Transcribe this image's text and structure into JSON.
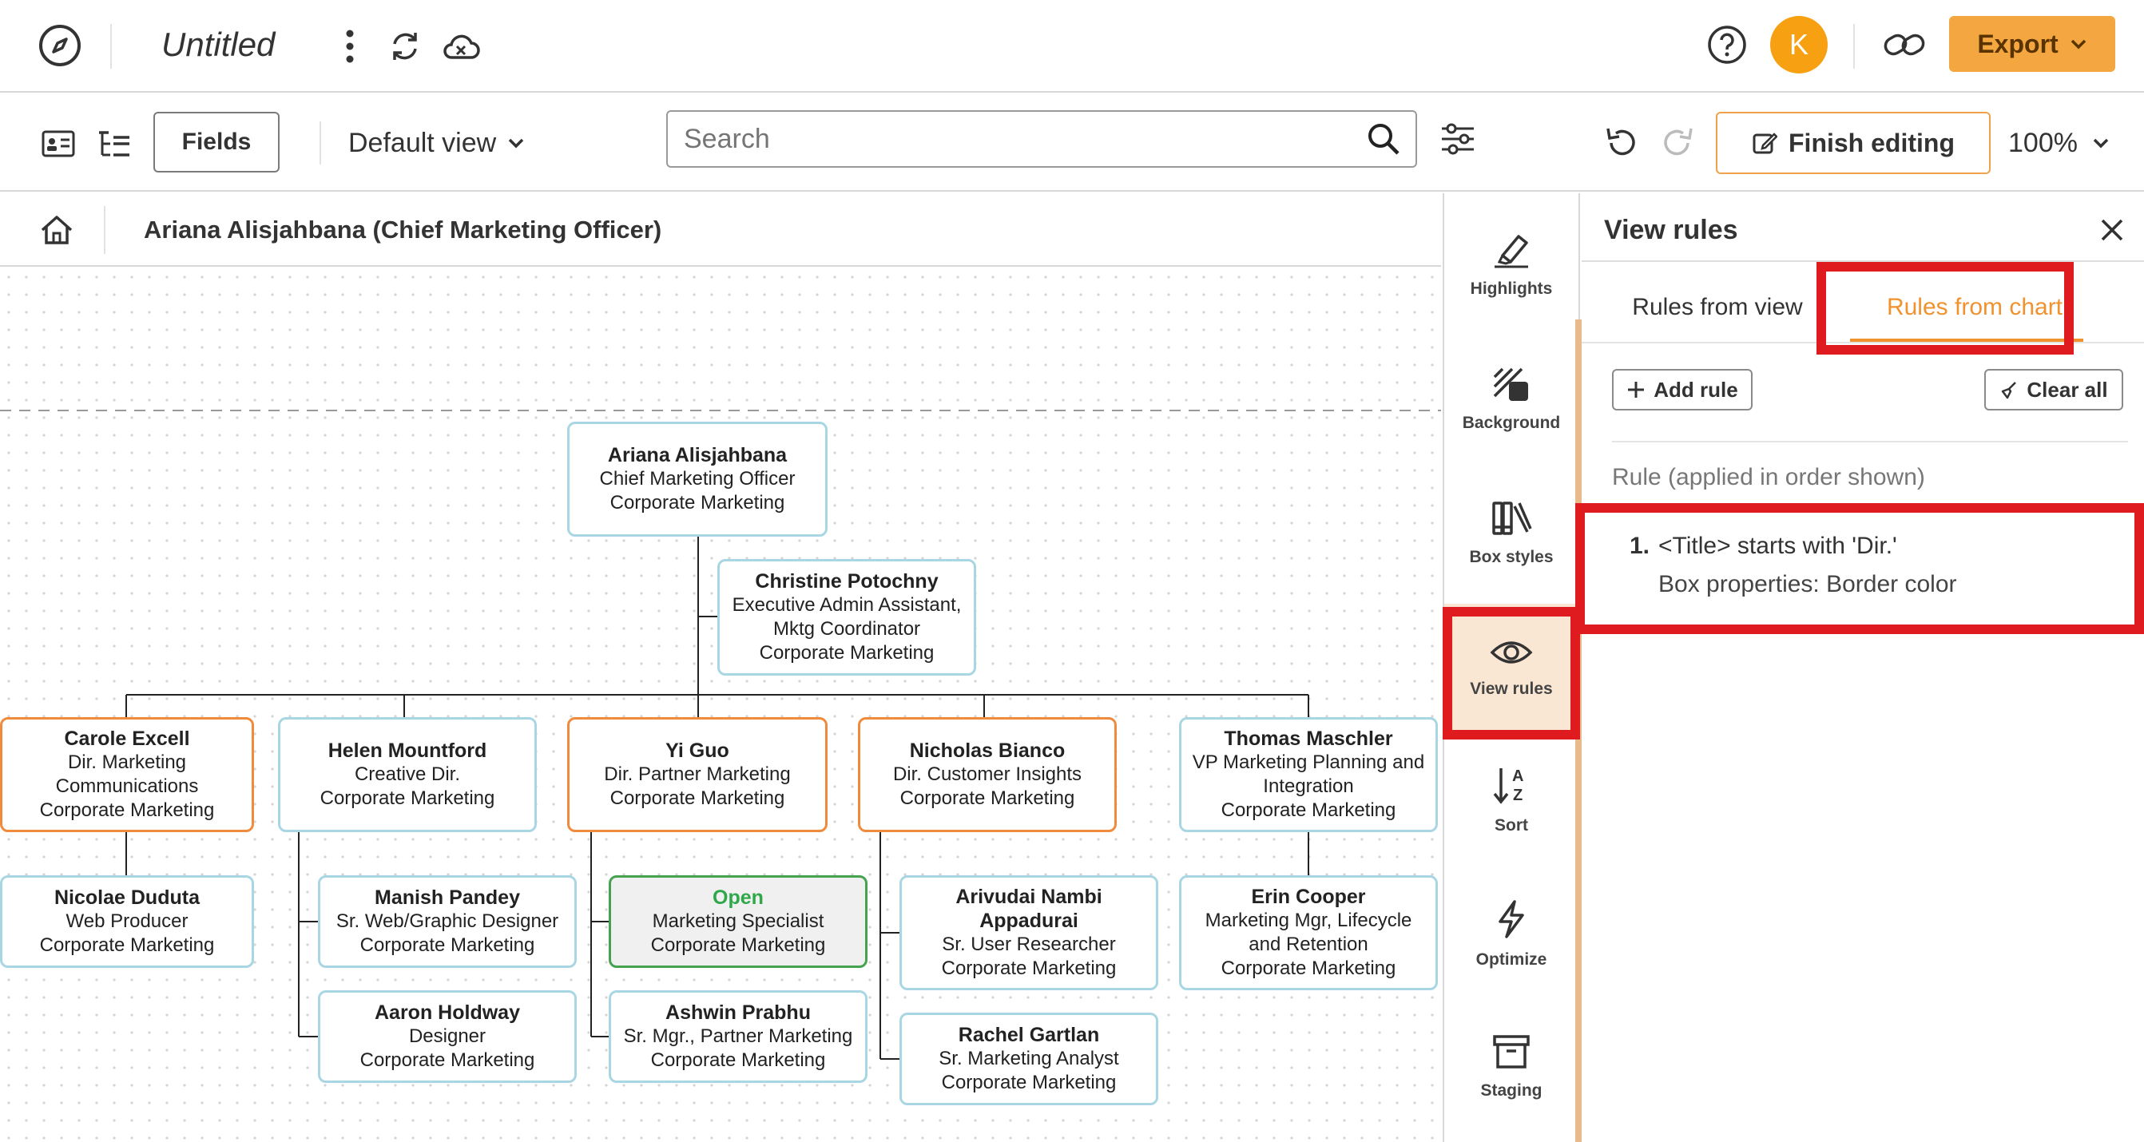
{
  "app": {
    "doc_title": "Untitled",
    "avatar_initial": "K",
    "export_label": "Export",
    "brand_color": "#f4a640"
  },
  "toolbar": {
    "fields_label": "Fields",
    "view_label": "Default view",
    "search_placeholder": "Search",
    "finish_label": "Finish editing",
    "zoom_label": "100%"
  },
  "breadcrumb": {
    "title": "Ariana Alisjahbana (Chief Marketing Officer)"
  },
  "chart": {
    "nodes": [
      {
        "id": "ariana",
        "name": "Ariana Alisjahbana",
        "lines": [
          "Chief Marketing Officer",
          "Corporate Marketing"
        ],
        "style": "normal"
      },
      {
        "id": "christine",
        "name": "Christine Potochny",
        "lines": [
          "Executive Admin Assistant,",
          "Mktg Coordinator",
          "Corporate Marketing"
        ],
        "style": "normal"
      },
      {
        "id": "carole",
        "name": "Carole Excell",
        "lines": [
          "Dir. Marketing",
          "Communications",
          "Corporate Marketing"
        ],
        "style": "dir"
      },
      {
        "id": "helen",
        "name": "Helen Mountford",
        "lines": [
          "Creative Dir.",
          "Corporate Marketing"
        ],
        "style": "normal"
      },
      {
        "id": "yiguo",
        "name": "Yi Guo",
        "lines": [
          "Dir. Partner Marketing",
          "Corporate Marketing"
        ],
        "style": "dir"
      },
      {
        "id": "nicholas",
        "name": "Nicholas Bianco",
        "lines": [
          "Dir. Customer Insights",
          "Corporate Marketing"
        ],
        "style": "dir"
      },
      {
        "id": "thomas",
        "name": "Thomas Maschler",
        "lines": [
          "VP Marketing Planning and",
          "Integration",
          "Corporate Marketing"
        ],
        "style": "normal"
      },
      {
        "id": "nicolae",
        "name": "Nicolae Duduta",
        "lines": [
          "Web Producer",
          "Corporate Marketing"
        ],
        "style": "normal"
      },
      {
        "id": "manish",
        "name": "Manish Pandey",
        "lines": [
          "Sr. Web/Graphic Designer",
          "Corporate Marketing"
        ],
        "style": "normal"
      },
      {
        "id": "aaron",
        "name": "Aaron Holdway",
        "lines": [
          "Designer",
          "Corporate Marketing"
        ],
        "style": "normal"
      },
      {
        "id": "open",
        "name": "Open",
        "lines": [
          "Marketing Specialist",
          "Corporate Marketing"
        ],
        "style": "open"
      },
      {
        "id": "ashwin",
        "name": "Ashwin Prabhu",
        "lines": [
          "Sr. Mgr., Partner Marketing",
          "Corporate Marketing"
        ],
        "style": "normal"
      },
      {
        "id": "arivudai",
        "name": "Arivudai Nambi Appadurai",
        "lines": [
          "Sr. User Researcher",
          "Corporate Marketing"
        ],
        "style": "normal"
      },
      {
        "id": "rachel",
        "name": "Rachel Gartlan",
        "lines": [
          "Sr. Marketing Analyst",
          "Corporate Marketing"
        ],
        "style": "normal"
      },
      {
        "id": "erin",
        "name": "Erin Cooper",
        "lines": [
          "Marketing Mgr, Lifecycle",
          "and Retention",
          "Corporate Marketing"
        ],
        "style": "normal"
      }
    ],
    "colors": {
      "normal_border": "#a8d6e3",
      "dir_border": "#f08a3c",
      "open_border": "#45a350",
      "open_name": "#2ea84a"
    }
  },
  "rail": {
    "items": [
      {
        "id": "highlights",
        "label": "Highlights",
        "icon": "highlighter-icon"
      },
      {
        "id": "background",
        "label": "Background",
        "icon": "background-icon"
      },
      {
        "id": "box_styles",
        "label": "Box styles",
        "icon": "box-styles-icon"
      },
      {
        "id": "view_rules",
        "label": "View rules",
        "icon": "eye-icon"
      },
      {
        "id": "sort",
        "label": "Sort",
        "icon": "sort-az-icon"
      },
      {
        "id": "optimize",
        "label": "Optimize",
        "icon": "lightning-icon"
      },
      {
        "id": "staging",
        "label": "Staging",
        "icon": "archive-icon"
      }
    ]
  },
  "panel": {
    "title": "View rules",
    "tab_view": "Rules from view",
    "tab_chart": "Rules from chart",
    "add_rule": "Add rule",
    "clear_all": "Clear all",
    "rules_heading": "Rule (applied in order shown)",
    "rules": [
      {
        "number": "1.",
        "condition": "<Title> starts with 'Dir.'",
        "properties": "Box properties: Border color"
      }
    ]
  }
}
